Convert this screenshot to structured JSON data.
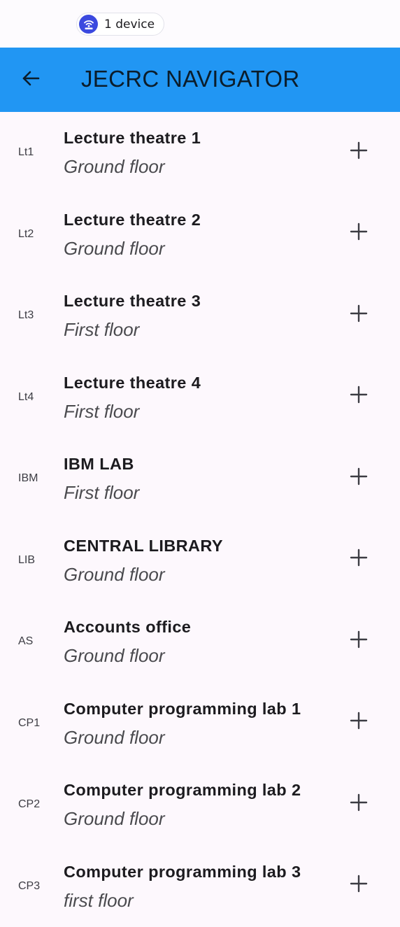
{
  "status_bar": {
    "device_chip": {
      "icon": "cast-device-icon",
      "label": "1 device"
    }
  },
  "app_bar": {
    "back_icon": "arrow-back-icon",
    "title": "JECRC NAVIGATOR",
    "background_color": "#2196f3"
  },
  "places": [
    {
      "code": "Lt1",
      "name": "Lecture theatre 1",
      "floor": "Ground floor",
      "action_icon": "plus-icon"
    },
    {
      "code": "Lt2",
      "name": "Lecture theatre 2",
      "floor": "Ground floor",
      "action_icon": "plus-icon"
    },
    {
      "code": "Lt3",
      "name": "Lecture theatre 3",
      "floor": "First floor",
      "action_icon": "plus-icon"
    },
    {
      "code": "Lt4",
      "name": "Lecture theatre 4",
      "floor": "First floor",
      "action_icon": "plus-icon"
    },
    {
      "code": "IBM",
      "name": "IBM LAB",
      "floor": "First floor",
      "action_icon": "plus-icon"
    },
    {
      "code": "LIB",
      "name": "CENTRAL LIBRARY",
      "floor": "Ground floor",
      "action_icon": "plus-icon"
    },
    {
      "code": "AS",
      "name": "Accounts office",
      "floor": "Ground floor",
      "action_icon": "plus-icon"
    },
    {
      "code": "CP1",
      "name": "Computer programming lab 1",
      "floor": "Ground floor",
      "action_icon": "plus-icon"
    },
    {
      "code": "CP2",
      "name": "Computer programming lab 2",
      "floor": "Ground floor",
      "action_icon": "plus-icon"
    },
    {
      "code": "CP3",
      "name": "Computer programming lab 3",
      "floor": "first floor",
      "action_icon": "plus-icon"
    }
  ]
}
